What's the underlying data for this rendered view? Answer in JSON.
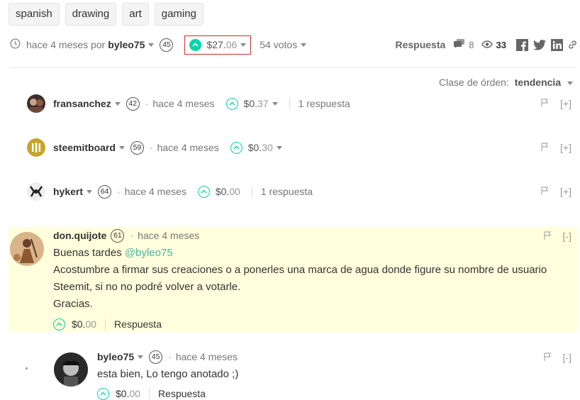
{
  "tags": [
    "spanish",
    "drawing",
    "art",
    "gaming"
  ],
  "post_info": {
    "time": "hace 4 meses por",
    "author": "byleo75",
    "reputation": "45",
    "payout_main": "$27.",
    "payout_cents": "06",
    "votes": "54 votos",
    "reply_label": "Respuesta",
    "comments_count": "8",
    "views_count": "33"
  },
  "sort": {
    "label": "Clase de órden:",
    "value": "tendencia"
  },
  "comments_collapsed": [
    {
      "author": "fransanchez",
      "reputation": "42",
      "time": "hace 4 meses",
      "payout_main": "$0.",
      "payout_cents": "37",
      "replies": "1 respuesta",
      "expand": "[+]"
    },
    {
      "author": "steemitboard",
      "reputation": "59",
      "time": "hace 4 meses",
      "payout_main": "$0.",
      "payout_cents": "30",
      "replies": "",
      "expand": "[+]"
    },
    {
      "author": "hykert",
      "reputation": "64",
      "time": "hace 4 meses",
      "payout_main": "$0.",
      "payout_cents": "00",
      "replies": "1 respuesta",
      "expand": "[+]"
    }
  ],
  "comment_main": {
    "author": "don.quijote",
    "reputation": "61",
    "time": "hace 4 meses",
    "line1_text": "Buenas tardes ",
    "line1_mention": "@byleo75",
    "line2": "Acostumbre a firmar sus creaciones o a ponerles una marca de agua donde figure su nombre de usuario",
    "line3": "Steemit, si no no podré volver a votarle.",
    "line4": "Gracias.",
    "payout_main": "$0.",
    "payout_cents": "00",
    "reply_label": "Respuesta",
    "collapse": "[-]"
  },
  "reply": {
    "author": "byleo75",
    "reputation": "45",
    "time": "hace 4 meses",
    "text": "esta bien, Lo tengo anotado ;)",
    "payout_main": "$0.",
    "payout_cents": "00",
    "reply_label": "Respuesta",
    "collapse": "[-]"
  },
  "colors": {
    "upvote": "#06d6a9",
    "highlight": "#ffffdd",
    "payout_border": "#c9302c"
  }
}
